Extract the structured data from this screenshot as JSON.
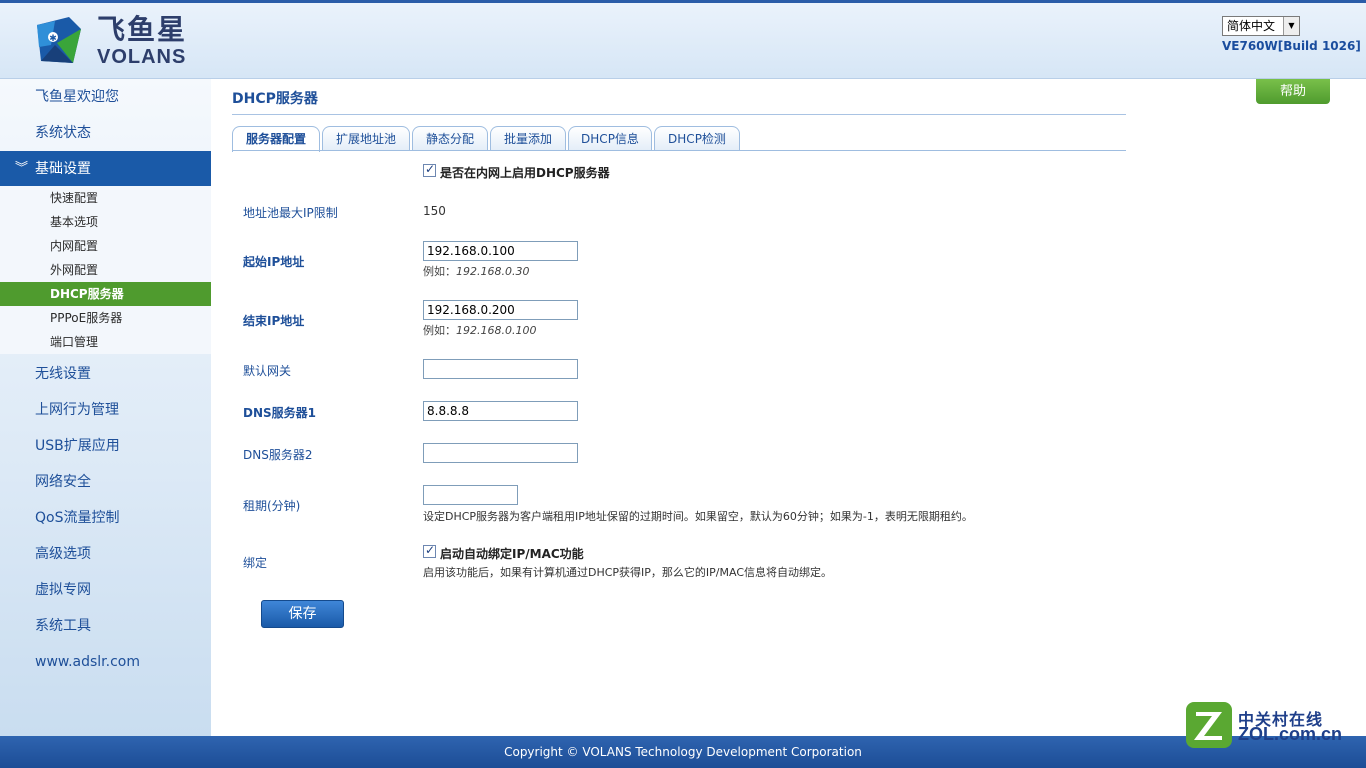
{
  "header": {
    "logo_cn": "飞鱼星",
    "logo_en": "VOLANS",
    "language": "简体中文",
    "model": "VE760W[Build 1026]"
  },
  "sidebar": {
    "items": [
      {
        "label": "飞鱼星欢迎您"
      },
      {
        "label": "系统状态"
      },
      {
        "label": "基础设置"
      },
      {
        "label": "无线设置"
      },
      {
        "label": "上网行为管理"
      },
      {
        "label": "USB扩展应用"
      },
      {
        "label": "网络安全"
      },
      {
        "label": "QoS流量控制"
      },
      {
        "label": "高级选项"
      },
      {
        "label": "虚拟专网"
      },
      {
        "label": "系统工具"
      },
      {
        "label": "www.adslr.com"
      }
    ],
    "sub_items": [
      {
        "label": "快速配置"
      },
      {
        "label": "基本选项"
      },
      {
        "label": "内网配置"
      },
      {
        "label": "外网配置"
      },
      {
        "label": "DHCP服务器"
      },
      {
        "label": "PPPoE服务器"
      },
      {
        "label": "端口管理"
      }
    ]
  },
  "main": {
    "title": "DHCP服务器",
    "help": "帮助",
    "tabs": [
      {
        "label": "服务器配置"
      },
      {
        "label": "扩展地址池"
      },
      {
        "label": "静态分配"
      },
      {
        "label": "批量添加"
      },
      {
        "label": "DHCP信息"
      },
      {
        "label": "DHCP检测"
      }
    ],
    "enable_label": "是否在内网上启用DHCP服务器",
    "pool_limit_label": "地址池最大IP限制",
    "pool_limit_value": "150",
    "start_ip_label": "起始IP地址",
    "start_ip_value": "192.168.0.100",
    "start_ip_hint_prefix": "例如：",
    "start_ip_hint_example": "192.168.0.30",
    "end_ip_label": "结束IP地址",
    "end_ip_value": "192.168.0.200",
    "end_ip_hint_prefix": "例如：",
    "end_ip_hint_example": "192.168.0.100",
    "gateway_label": "默认网关",
    "gateway_value": "",
    "dns1_label": "DNS服务器1",
    "dns1_value": "8.8.8.8",
    "dns2_label": "DNS服务器2",
    "dns2_value": "",
    "lease_label": "租期(分钟)",
    "lease_value": "",
    "lease_desc": "设定DHCP服务器为客户端租用IP地址保留的过期时间。如果留空，默认为60分钟；如果为-1，表明无限期租约。",
    "bind_label": "绑定",
    "bind_check_label": "启动自动绑定IP/MAC功能",
    "bind_desc": "启用该功能后，如果有计算机通过DHCP获得IP，那么它的IP/MAC信息将自动绑定。",
    "save": "保存"
  },
  "footer": {
    "copyright": "Copyright © VOLANS Technology Development Corporation"
  },
  "watermark": {
    "cn": "中关村在线",
    "en": "ZOL.com.cn"
  }
}
